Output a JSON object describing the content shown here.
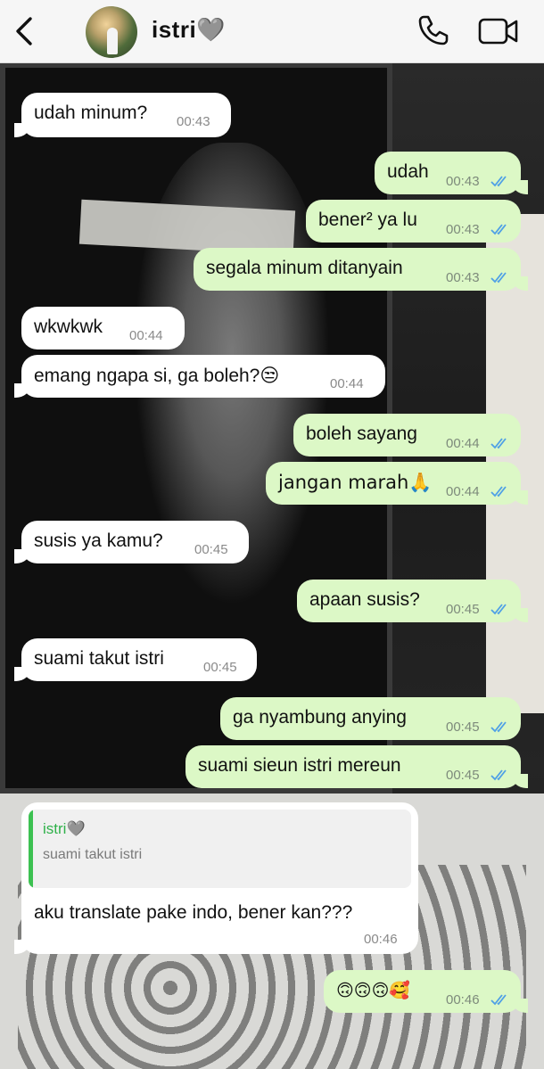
{
  "header": {
    "contact_name": "istri🩶",
    "back_icon": "chevron-left-icon",
    "call_icon": "phone-icon",
    "video_icon": "video-camera-icon"
  },
  "colors": {
    "incoming_bubble": "#ffffff",
    "outgoing_bubble": "#dcf8c6",
    "read_ticks": "#4fa0e6",
    "reply_accent": "#3cc151"
  },
  "messages": [
    {
      "dir": "in",
      "text": "udah minum?",
      "time": "00:43"
    },
    {
      "dir": "out",
      "text": "udah",
      "time": "00:43"
    },
    {
      "dir": "out",
      "text": "bener² ya lu",
      "time": "00:43"
    },
    {
      "dir": "out",
      "text": "segala minum ditanyain",
      "time": "00:43"
    },
    {
      "dir": "in",
      "text": "wkwkwk",
      "time": "00:44"
    },
    {
      "dir": "in",
      "text": "emang ngapa si, ga boleh?😒",
      "time": "00:44"
    },
    {
      "dir": "out",
      "text": "boleh sayang",
      "time": "00:44"
    },
    {
      "dir": "out",
      "text": "jangan marah🙏",
      "time": "00:44"
    },
    {
      "dir": "in",
      "text": "susis ya kamu?",
      "time": "00:45"
    },
    {
      "dir": "out",
      "text": "apaan susis?",
      "time": "00:45"
    },
    {
      "dir": "in",
      "text": "suami takut istri",
      "time": "00:45"
    },
    {
      "dir": "out",
      "text": "ga nyambung anying",
      "time": "00:45"
    },
    {
      "dir": "out",
      "text": "suami sieun istri mereun",
      "time": "00:45"
    },
    {
      "dir": "in",
      "text": "aku translate pake indo, bener kan???",
      "time": "00:46",
      "reply_to": {
        "name": "istri🩶",
        "text": "suami takut istri"
      }
    },
    {
      "dir": "out",
      "text": "🙃🙃🙃🥰",
      "time": "00:46"
    }
  ]
}
